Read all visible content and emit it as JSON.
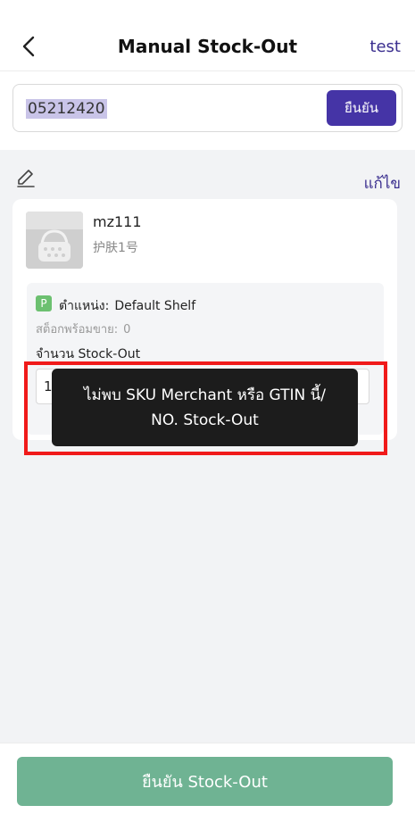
{
  "header": {
    "title": "Manual Stock-Out",
    "back_icon": "chevron-left-icon",
    "action_label": "test"
  },
  "scan": {
    "value": "05212420",
    "confirm_label": "ยืนยัน"
  },
  "edit": {
    "icon": "pencil-icon",
    "label": "แก้ไข"
  },
  "product": {
    "name": "mz111",
    "variant": "护肤1号",
    "location_badge": "P",
    "location_label": "ตำแหน่ง:",
    "location_value": "Default Shelf",
    "available_label": "สต็อกพร้อมขาย:",
    "available_value": "0",
    "qty_label": "จำนวน Stock-Out",
    "qty_value": "1"
  },
  "toast": {
    "line1": "ไม่พบ SKU Merchant หรือ GTIN นี้/",
    "line2": "NO. Stock-Out"
  },
  "footer": {
    "submit_label": "ยืนยัน Stock-Out"
  },
  "colors": {
    "accent": "#4534a6",
    "submit": "#6fb393",
    "highlight": "#f01a1a",
    "badge": "#6cc070"
  }
}
